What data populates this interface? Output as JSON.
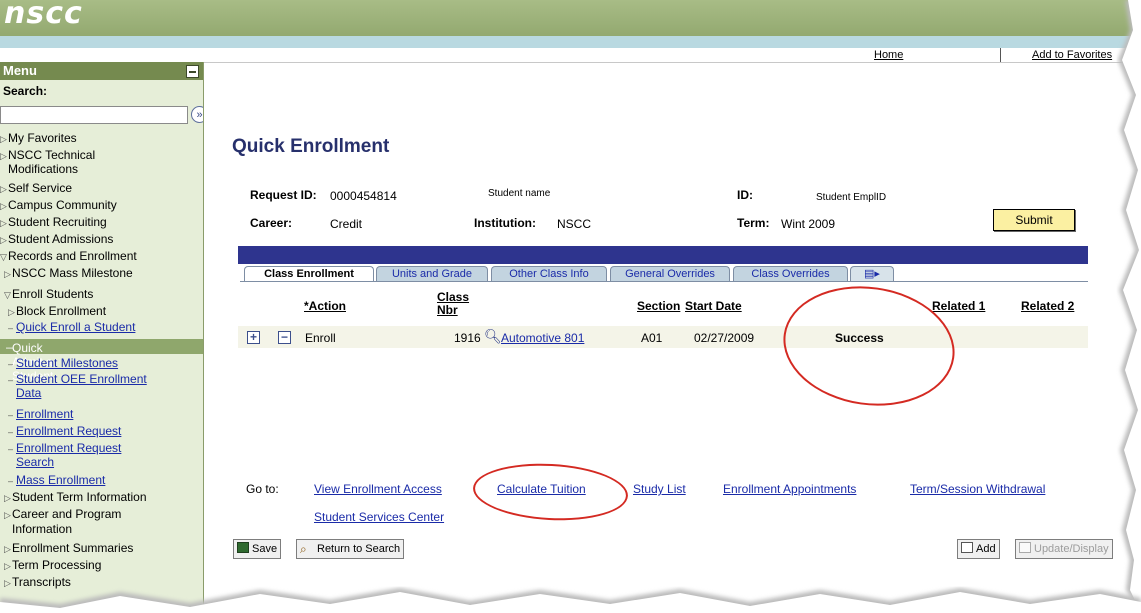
{
  "brand": {
    "logo": "nscc",
    "accent": "#758a4f"
  },
  "toplinks": {
    "home": "Home",
    "favorites": "Add to Favorites"
  },
  "menu": {
    "title": "Menu",
    "search_label": "Search:",
    "search_value": "",
    "items": [
      {
        "label": "My Favorites"
      },
      {
        "label": "NSCC Technical"
      },
      {
        "label": "Modifications"
      },
      {
        "label": "Self Service"
      },
      {
        "label": "Campus Community"
      },
      {
        "label": "Student Recruiting"
      },
      {
        "label": "Student Admissions"
      },
      {
        "label": "Records and Enrollment"
      },
      {
        "label": "NSCC Mass Milestone"
      },
      {
        "label": "Enroll Students"
      },
      {
        "label": "Block Enrollment"
      },
      {
        "label": "Quick Enroll a Student"
      },
      {
        "label": "Quick Admit a Student"
      },
      {
        "label": "Student Milestones"
      },
      {
        "label": "Student OEE Enrollment"
      },
      {
        "label": "Data"
      },
      {
        "label": "Enrollment"
      },
      {
        "label": "Enrollment Request"
      },
      {
        "label": "Enrollment Request"
      },
      {
        "label": "Search"
      },
      {
        "label": "Mass Enrollment"
      },
      {
        "label": "Student Term Information"
      },
      {
        "label": "Career and Program"
      },
      {
        "label": "Information"
      },
      {
        "label": "Enrollment Summaries"
      },
      {
        "label": "Term Processing"
      },
      {
        "label": "Transcripts"
      }
    ]
  },
  "page": {
    "title": "Quick Enrollment",
    "request_id_label": "Request ID:",
    "request_id": "0000454814",
    "student_name": "Student name",
    "id_label": "ID:",
    "id_value": "Student EmplID",
    "career_label": "Career:",
    "career": "Credit",
    "institution_label": "Institution:",
    "institution": "NSCC",
    "term_label": "Term:",
    "term": "Wint 2009",
    "submit": "Submit"
  },
  "grid": {
    "tabs": [
      "Class Enrollment",
      "Units and Grade",
      "Other Class Info",
      "General Overrides",
      "Class Overrides"
    ],
    "headers": {
      "action": "*Action",
      "class_nbr_1": "Class",
      "class_nbr_2": "Nbr",
      "section": "Section",
      "start_date": "Start Date",
      "related1": "Related 1",
      "related2": "Related 2"
    },
    "row": {
      "action": "Enroll",
      "class_nbr": "1916",
      "course": "Automotive 801",
      "section": "A01",
      "start_date": "02/27/2009",
      "status": "Success"
    }
  },
  "goto": {
    "label": "Go to:",
    "links": [
      "View Enrollment Access",
      "Calculate Tuition",
      "Study List",
      "Enrollment Appointments",
      "Term/Session Withdrawal",
      "Student Services Center"
    ]
  },
  "buttons": {
    "save": "Save",
    "return": "Return to Search",
    "add": "Add",
    "update": "Update/Display"
  },
  "annotation_color": "#d42a22"
}
